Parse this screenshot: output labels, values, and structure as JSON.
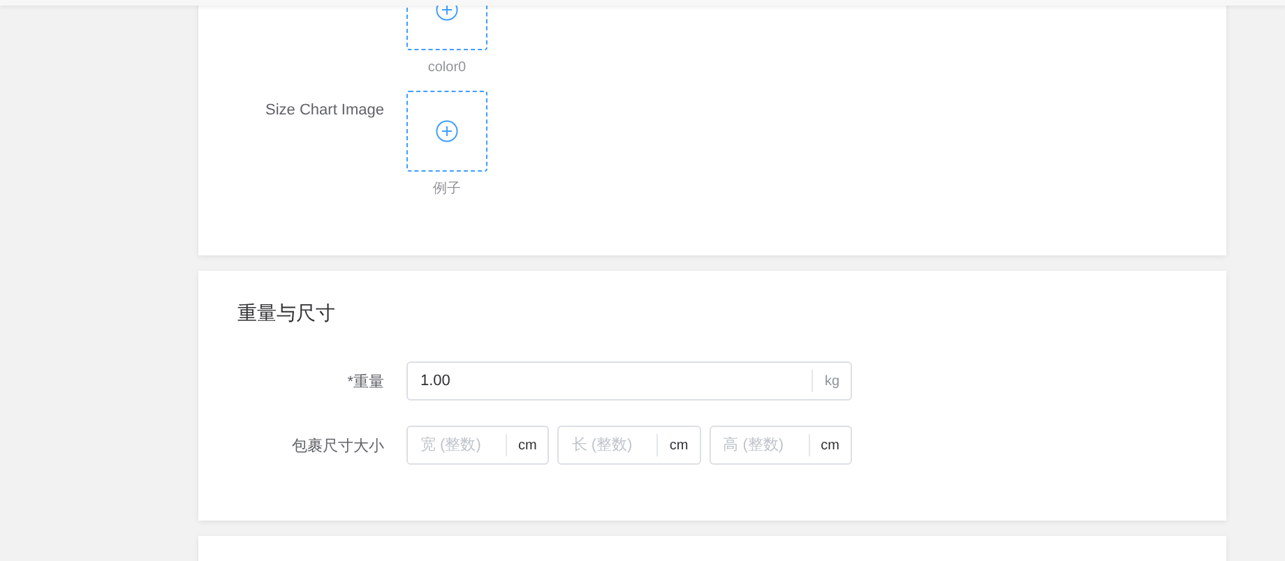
{
  "image_section": {
    "uploads": [
      {
        "caption": "color0"
      },
      {
        "label": "Size Chart Image",
        "caption": "例子"
      }
    ]
  },
  "weight_section": {
    "title": "重量与尺寸",
    "weight": {
      "label": "*重量",
      "value": "1.00",
      "unit": "kg"
    },
    "package_size": {
      "label": "包裹尺寸大小",
      "fields": [
        {
          "placeholder": "宽 (整数)",
          "unit": "cm"
        },
        {
          "placeholder": "长 (整数)",
          "unit": "cm"
        },
        {
          "placeholder": "高 (整数)",
          "unit": "cm"
        }
      ]
    }
  }
}
